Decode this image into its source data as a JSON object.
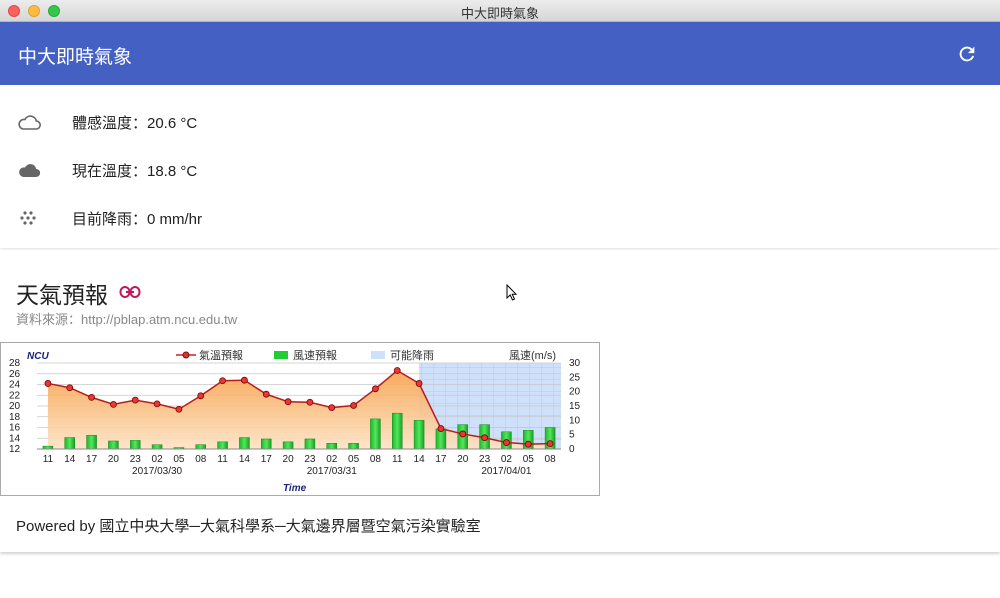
{
  "window": {
    "title": "中大即時氣象"
  },
  "appbar": {
    "title": "中大即時氣象",
    "refresh_icon": "refresh-icon"
  },
  "current": {
    "items": [
      {
        "icon": "cloud-outline-icon",
        "text": "體感溫度：20.6 °C"
      },
      {
        "icon": "cloud-filled-icon",
        "text": "現在溫度：18.8 °C"
      },
      {
        "icon": "rain-dots-icon",
        "text": "目前降雨：0 mm/hr"
      }
    ]
  },
  "forecast": {
    "title": "天氣預報",
    "link_icon": "link-icon",
    "source": "資料來源：http://pblap.atm.ncu.edu.tw",
    "powered_by": "Powered by 國立中央大學─大氣科學系─大氣邊界層暨空氣污染實驗室"
  },
  "chart_data": {
    "type": "bar",
    "station": "NCU",
    "legend": [
      "氣溫預報",
      "風速預報",
      "可能降雨"
    ],
    "y2label": "風速(m/s)",
    "xlabel": "Time",
    "x_ticks": [
      "11",
      "14",
      "17",
      "20",
      "23",
      "02",
      "05",
      "08",
      "11",
      "14",
      "17",
      "20",
      "23",
      "02",
      "05",
      "08",
      "11",
      "14",
      "17",
      "20",
      "23",
      "02",
      "05",
      "08"
    ],
    "date_labels": [
      {
        "at": 5.5,
        "text": "2017/03/30"
      },
      {
        "at": 13.5,
        "text": "2017/03/31"
      },
      {
        "at": 21.5,
        "text": "2017/04/01"
      }
    ],
    "y_ticks": [
      12,
      14,
      16,
      18,
      20,
      22,
      24,
      26,
      28
    ],
    "y2_ticks": [
      0,
      5,
      10,
      15,
      20,
      25,
      30
    ],
    "ylim": [
      12,
      28
    ],
    "y2lim": [
      0,
      30
    ],
    "rain_region_start_index": 17.5,
    "series": [
      {
        "name": "氣溫預報",
        "type": "line",
        "color": "#cc2222",
        "values": [
          24.2,
          23.4,
          21.6,
          20.3,
          21.1,
          20.4,
          19.4,
          21.9,
          24.7,
          24.8,
          22.2,
          20.8,
          20.7,
          19.7,
          20.1,
          23.2,
          26.6,
          24.2,
          15.8,
          14.8,
          14.1,
          13.2,
          12.9,
          13.0
        ]
      },
      {
        "name": "風速預報",
        "type": "bar",
        "color": "#22cc33",
        "values": [
          1.0,
          4.0,
          4.8,
          2.8,
          3.0,
          1.5,
          0.5,
          1.5,
          2.5,
          4.0,
          3.5,
          2.5,
          3.5,
          2.0,
          2.0,
          10.5,
          12.5,
          10.0,
          7.0,
          8.5,
          8.5,
          6.0,
          6.5,
          7.5
        ]
      }
    ]
  }
}
